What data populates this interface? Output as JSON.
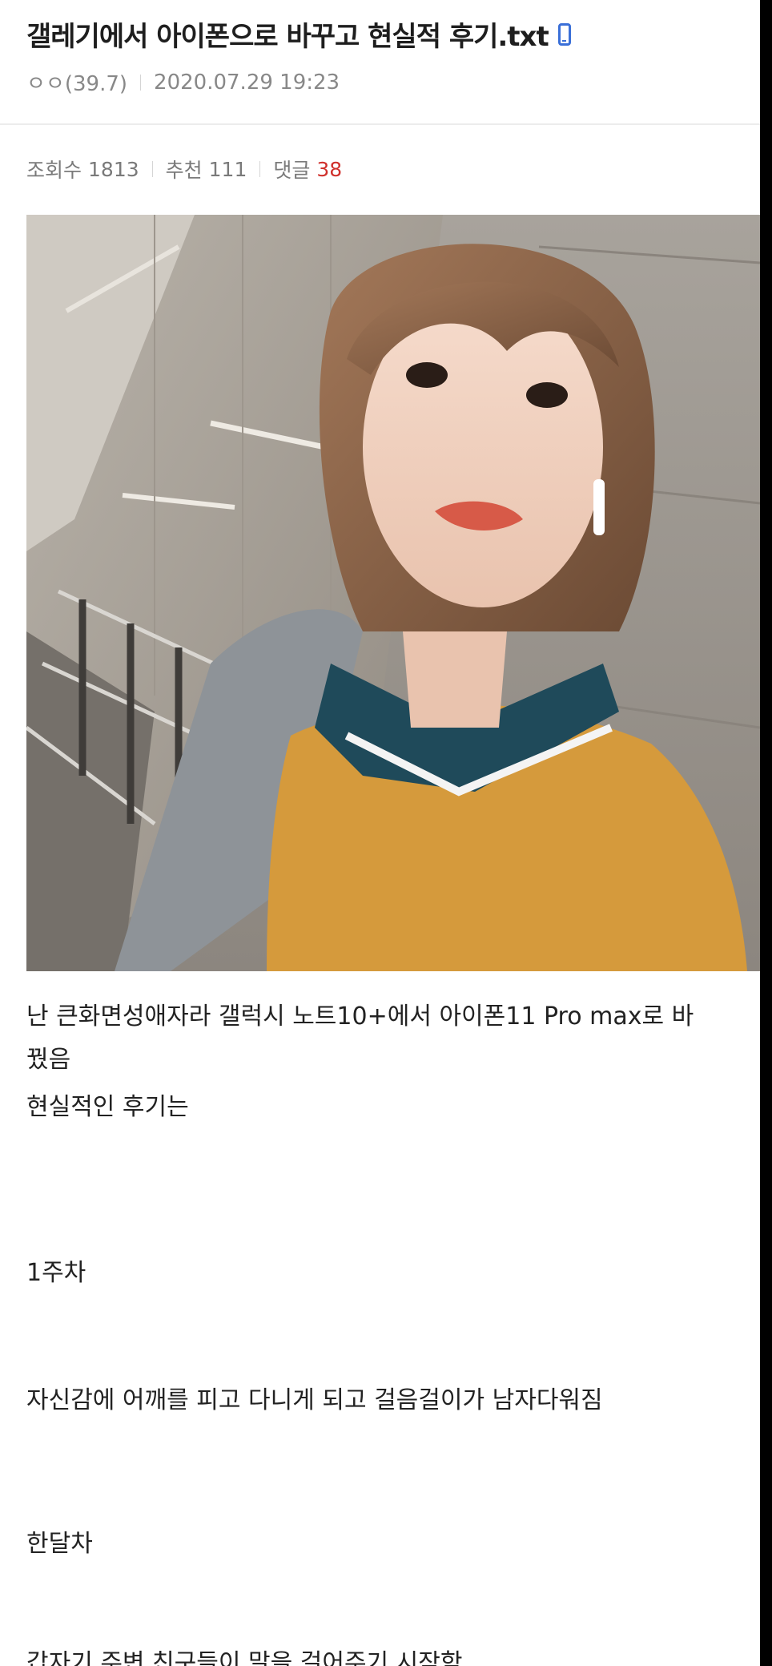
{
  "post": {
    "title": "갤레기에서 아이폰으로 바꾸고 현실적 후기.txt",
    "title_icon": "mobile-phone-icon",
    "author": "ㅇㅇ(39.7)",
    "datetime": "2020.07.29 19:23",
    "stats": {
      "views_label": "조회수",
      "views": "1813",
      "recommend_label": "추천",
      "recommend": "111",
      "comments_label": "댓글",
      "comments": "38"
    },
    "body": {
      "line1": "난 큰화면성애자라 갤럭시 노트10+에서 아이폰11 Pro max로 바",
      "line1b": "꿨음",
      "line2": "현실적인 후기는",
      "line3": "1주차",
      "line4": "자신감에 어깨를 피고 다니게 되고 걸음걸이가 남자다워짐",
      "line5": "한달차",
      "line6": "갑자기 주변 친구들이 말을 걸어주기 시작함"
    }
  },
  "colors": {
    "title": "#1e1e1e",
    "meta": "#888888",
    "accent_count": "#d0312d",
    "icon": "#3a6fd8",
    "page_bg": "#ffffff"
  }
}
